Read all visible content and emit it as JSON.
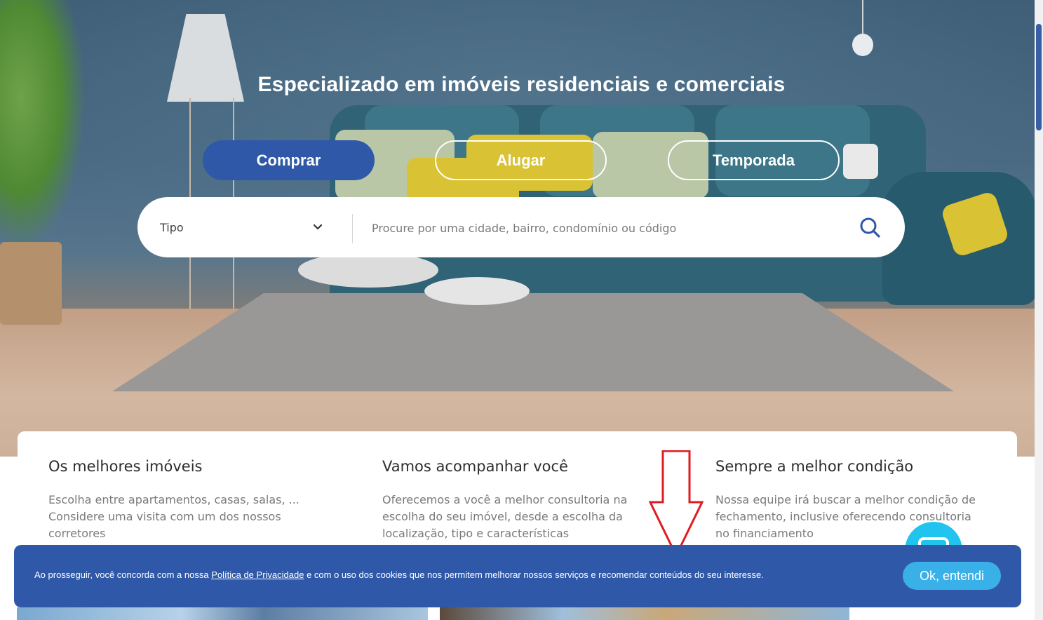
{
  "hero": {
    "title": "Especializado em imóveis residenciais e comerciais",
    "tabs": [
      {
        "label": "Comprar",
        "active": true
      },
      {
        "label": "Alugar",
        "active": false
      },
      {
        "label": "Temporada",
        "active": false
      }
    ]
  },
  "search": {
    "type_label": "Tipo",
    "placeholder": "Procure por uma cidade, bairro, condomínio ou código"
  },
  "features": [
    {
      "title": "Os melhores imóveis",
      "text": "Escolha entre apartamentos, casas, salas, ... Considere uma visita com um dos nossos corretores"
    },
    {
      "title": "Vamos acompanhar você",
      "text": "Oferecemos a você a melhor consultoria na escolha do seu imóvel, desde a escolha da localização, tipo e características"
    },
    {
      "title": "Sempre a melhor condição",
      "text": "Nossa equipe irá buscar a melhor condição de fechamento, inclusive oferecendo consultoria no financiamento"
    }
  ],
  "cookie": {
    "text_before": "Ao prosseguir, você concorda com a nossa ",
    "link": "Política de Privacidade",
    "text_after": " e com o uso dos cookies que nos permitem melhorar nossos serviços e recomendar conteúdos do seu interesse.",
    "button": "Ok, entendi"
  },
  "colors": {
    "primary": "#2f58a8",
    "accent": "#3ab0e8",
    "chat": "#20c4ee",
    "arrow": "#e11b22"
  },
  "icons": [
    "chevron-down-icon",
    "search-icon",
    "chat-icon",
    "arrow-down-icon"
  ]
}
